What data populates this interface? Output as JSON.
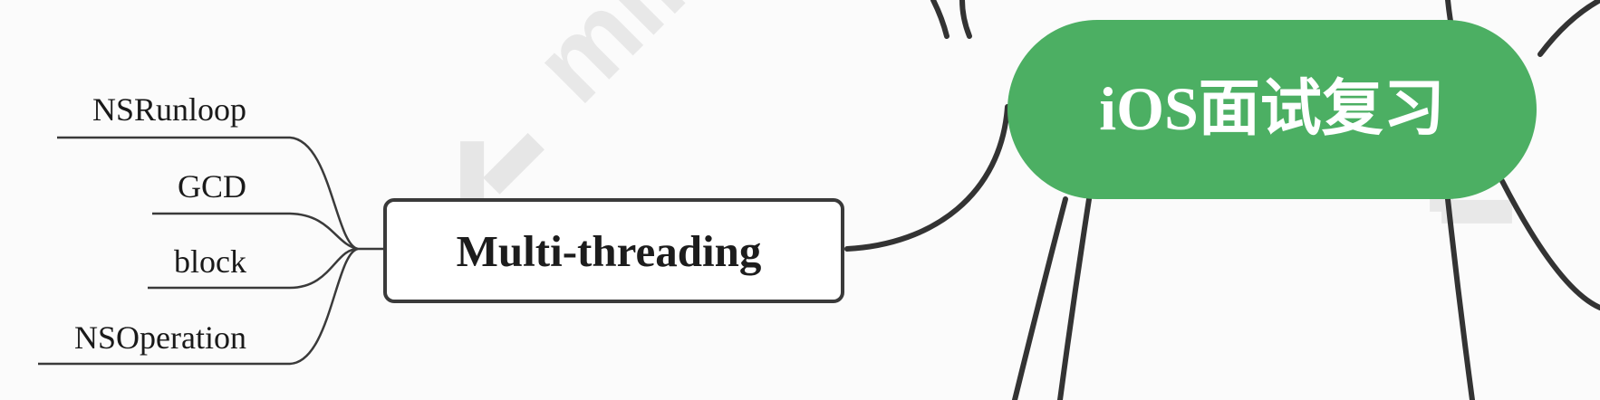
{
  "mindmap": {
    "root": {
      "label": "iOS面试复习",
      "fill_color": "#4caf63"
    },
    "branch": {
      "label": "Multi-threading",
      "children": [
        {
          "label": "NSRunloop"
        },
        {
          "label": "GCD"
        },
        {
          "label": "block"
        },
        {
          "label": "NSOperation"
        }
      ]
    },
    "connector_color": "#333333",
    "leaf_line_color": "#3a3a3a"
  },
  "watermark": {
    "text": "mindmaster",
    "logo": "mindmaster-logo-icon"
  }
}
